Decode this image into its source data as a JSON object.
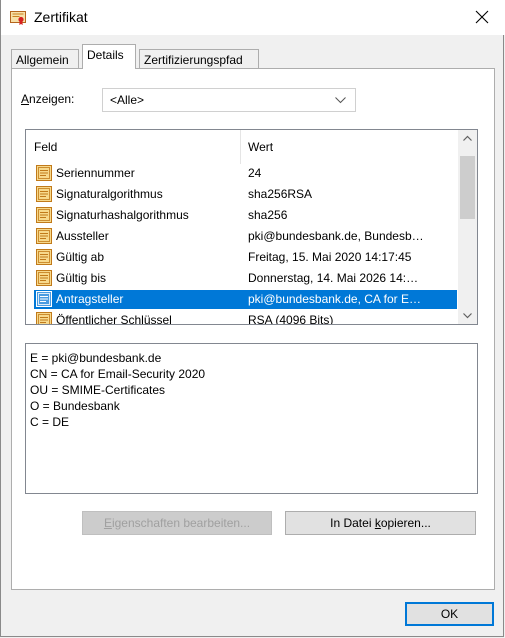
{
  "window": {
    "title": "Zertifikat"
  },
  "tabs": [
    {
      "label": "Allgemein",
      "active": false
    },
    {
      "label": "Details",
      "active": true
    },
    {
      "label": "Zertifizierungspfad",
      "active": false
    }
  ],
  "show": {
    "label_prefix": "",
    "label_accel": "A",
    "label_rest": "nzeigen:",
    "selected": "<Alle>"
  },
  "list": {
    "columns": [
      "Feld",
      "Wert"
    ],
    "rows": [
      {
        "field": "Seriennummer",
        "value": "24",
        "selected": false
      },
      {
        "field": "Signaturalgorithmus",
        "value": "sha256RSA",
        "selected": false
      },
      {
        "field": "Signaturhashalgorithmus",
        "value": "sha256",
        "selected": false
      },
      {
        "field": "Aussteller",
        "value": "pki@bundesbank.de, Bundesb…",
        "selected": false
      },
      {
        "field": "Gültig ab",
        "value": "Freitag, 15. Mai 2020 14:17:45",
        "selected": false
      },
      {
        "field": "Gültig bis",
        "value": "Donnerstag, 14. Mai 2026 14:…",
        "selected": false
      },
      {
        "field": "Antragsteller",
        "value": "pki@bundesbank.de, CA for E…",
        "selected": true
      },
      {
        "field": "Öffentlicher Schlüssel",
        "value": "RSA (4096 Bits)",
        "selected": false
      }
    ]
  },
  "details": {
    "lines": [
      "E = pki@bundesbank.de",
      "CN = CA for Email-Security 2020",
      "OU = SMIME-Certificates",
      "O = Bundesbank",
      "C = DE"
    ]
  },
  "buttons": {
    "edit_accel": "E",
    "edit_rest": "igenschaften bearbeiten...",
    "copy_pre": "In Datei ",
    "copy_accel": "k",
    "copy_rest": "opieren...",
    "ok": "OK"
  },
  "colors": {
    "selection": "#0078d7",
    "accent": "#0078d7"
  }
}
